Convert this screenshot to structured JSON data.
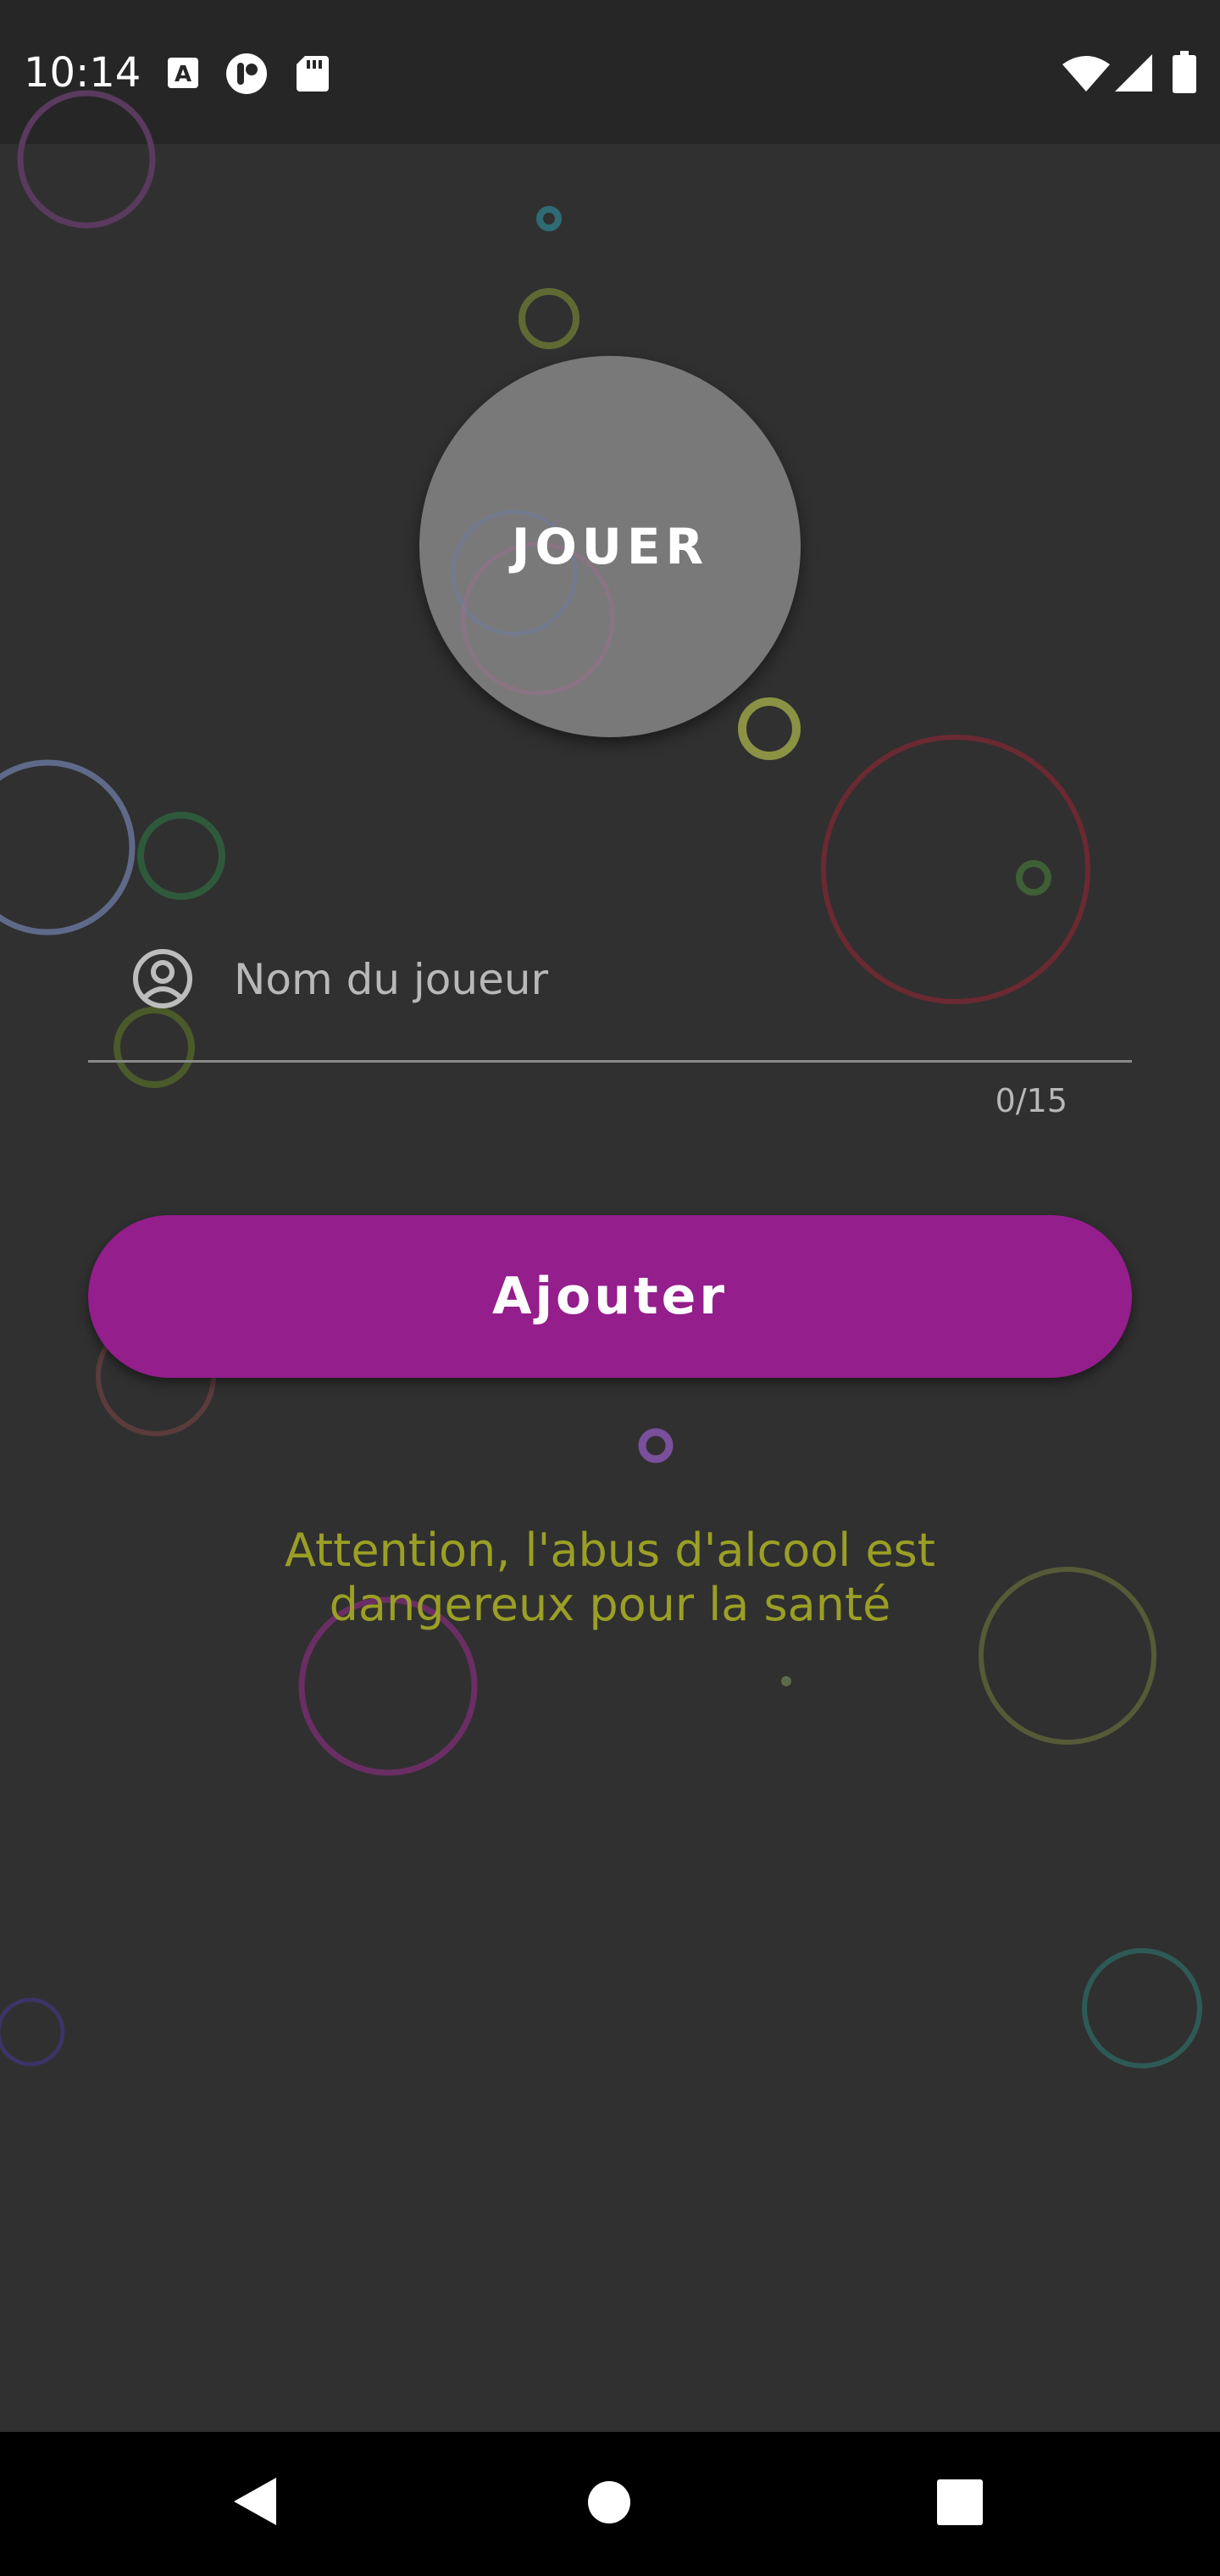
{
  "status_bar": {
    "time": "10:14",
    "left_icons": [
      "text-recognition-icon",
      "app-notification-icon",
      "sd-card-icon"
    ],
    "right_icons": [
      "wifi-icon",
      "cellular-signal-icon",
      "battery-icon"
    ]
  },
  "main": {
    "play_label": "JOUER",
    "player_input": {
      "placeholder": "Nom du joueur",
      "value": "",
      "counter": "0/15"
    },
    "add_label": "Ajouter",
    "warning": "Attention, l'abus d'alcool est dangereux pour la santé"
  },
  "nav_bar": {
    "buttons": [
      "back-icon",
      "home-icon",
      "recents-icon"
    ]
  },
  "colors": {
    "background": "#303030",
    "accent": "#931e8c",
    "warning": "#9a9f25",
    "play_button": "#808080"
  }
}
